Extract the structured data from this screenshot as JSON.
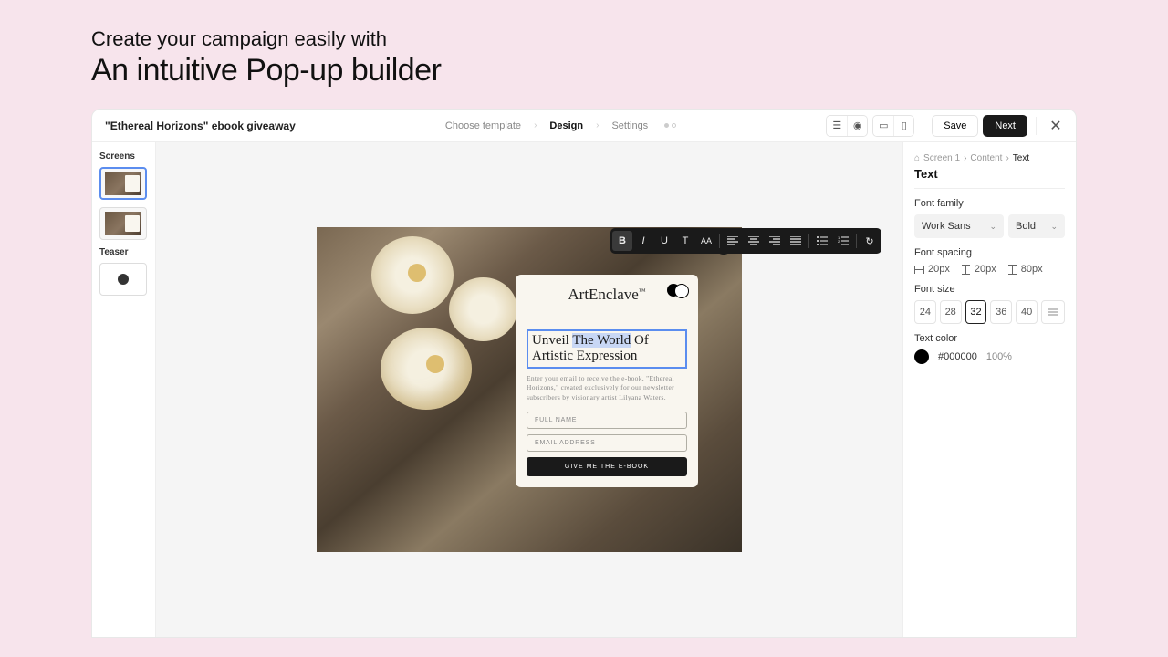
{
  "hero": {
    "subtitle": "Create your campaign easily with",
    "title": "An intuitive Pop-up builder"
  },
  "topbar": {
    "campaign": "\"Ethereal Horizons\" ebook giveaway",
    "steps": [
      "Choose template",
      "Design",
      "Settings"
    ],
    "save": "Save",
    "next": "Next"
  },
  "sidebar": {
    "screens_label": "Screens",
    "teaser_label": "Teaser"
  },
  "popup": {
    "brand": "ArtEnclave",
    "brand_tm": "™",
    "heading_pre": "Unveil ",
    "heading_sel": "The World",
    "heading_post": " Of Artistic Expression",
    "description": "Enter your email to receive the e-book, \"Ethereal Horizons,\" created exclusively for our newsletter subscribers by visionary artist Lilyana Waters.",
    "field_name": "FULL NAME",
    "field_email": "EMAIL ADDRESS",
    "cta": "GIVE ME THE E-BOOK"
  },
  "panel": {
    "crumbs": [
      "Screen 1",
      "Content",
      "Text"
    ],
    "title": "Text",
    "font_family_label": "Font family",
    "font_family": "Work Sans",
    "font_weight": "Bold",
    "spacing_label": "Font spacing",
    "spacing_options": [
      "20px",
      "20px",
      "80px"
    ],
    "size_label": "Font size",
    "sizes": [
      "24",
      "28",
      "32",
      "36",
      "40"
    ],
    "color_label": "Text color",
    "color_hex": "#000000",
    "color_alpha": "100%"
  }
}
